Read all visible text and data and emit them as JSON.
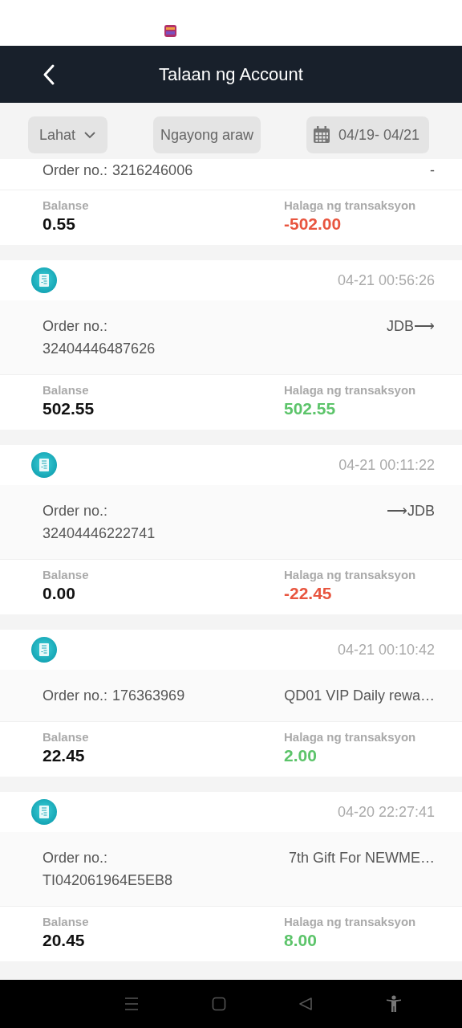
{
  "header": {
    "title": "Talaan ng Account"
  },
  "filters": [
    {
      "kind": "dropdown",
      "label": "Lahat"
    },
    {
      "kind": "plain",
      "label": "Ngayong araw"
    },
    {
      "kind": "date",
      "label": "04/19- 04/21"
    }
  ],
  "transactions": [
    {
      "order_label": "Order no.:",
      "order_number": "3216246006",
      "stacked": false,
      "detail": "-",
      "balance_label": "Balanse",
      "balance": "0.55",
      "amount_label": "Halaga ng transaksyon",
      "amount": "-502.00",
      "kind": "debit"
    },
    {
      "time": "04-21 00:56:26",
      "order_label": "Order no.:",
      "order_number": "32404446487626",
      "stacked": true,
      "detail": "JDB⟶",
      "balance_label": "Balanse",
      "balance": "502.55",
      "amount_label": "Halaga ng transaksyon",
      "amount": "502.55",
      "kind": "credit"
    },
    {
      "time": "04-21 00:11:22",
      "order_label": "Order no.:",
      "order_number": "32404446222741",
      "stacked": true,
      "detail": "⟶JDB",
      "balance_label": "Balanse",
      "balance": "0.00",
      "amount_label": "Halaga ng transaksyon",
      "amount": "-22.45",
      "kind": "debit"
    },
    {
      "time": "04-21 00:10:42",
      "order_label": "Order no.:",
      "order_number": "176363969",
      "stacked": false,
      "detail": "QD01 VIP Daily rewa…",
      "balance_label": "Balanse",
      "balance": "22.45",
      "amount_label": "Halaga ng transaksyon",
      "amount": "2.00",
      "kind": "credit"
    },
    {
      "time": "04-20 22:27:41",
      "order_label": "Order no.:",
      "order_number": "TI042061964E5EB8",
      "stacked": true,
      "detail": "7th Gift For NEWME…",
      "balance_label": "Balanse",
      "balance": "20.45",
      "amount_label": "Halaga ng transaksyon",
      "amount": "8.00",
      "kind": "credit"
    }
  ]
}
